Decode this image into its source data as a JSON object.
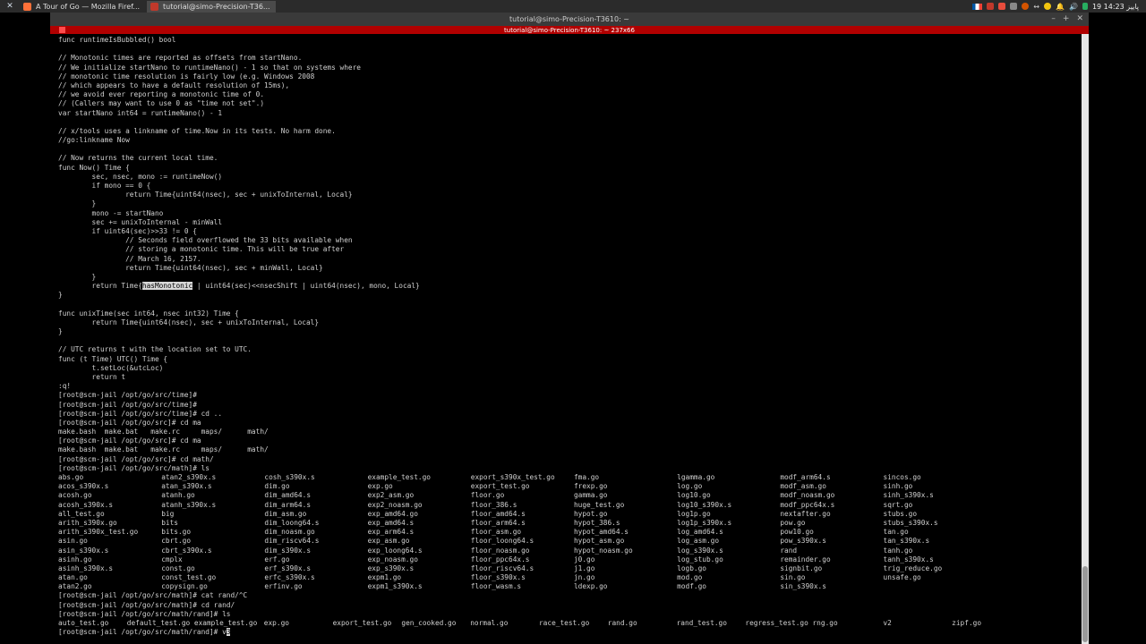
{
  "taskbar": {
    "tasks": [
      {
        "label": "A Tour of Go — Mozilla Firef...",
        "icon": "firefox-icon"
      },
      {
        "label": "tutorial@simo-Precision-T36...",
        "icon": "terminal-icon"
      }
    ],
    "clock": "19 پاییز 14:23"
  },
  "window": {
    "title": "tutorial@simo-Precision-T3610: ~",
    "tab_title": "tutorial@simo-Precision-T3610: ~ 237x66"
  },
  "terminal": {
    "code_lines": [
      "func runtimeIsBubbled() bool",
      "",
      "// Monotonic times are reported as offsets from startNano.",
      "// We initialize startNano to runtimeNano() - 1 so that on systems where",
      "// monotonic time resolution is fairly low (e.g. Windows 2008",
      "// which appears to have a default resolution of 15ms),",
      "// we avoid ever reporting a monotonic time of 0.",
      "// (Callers may want to use 0 as \"time not set\".)",
      "var startNano int64 = runtimeNano() - 1",
      "",
      "// x/tools uses a linkname of time.Now in its tests. No harm done.",
      "//go:linkname Now",
      "",
      "// Now returns the current local time.",
      "func Now() Time {",
      "        sec, nsec, mono := runtimeNow()",
      "        if mono == 0 {",
      "                return Time{uint64(nsec), sec + unixToInternal, Local}",
      "        }",
      "        mono -= startNano",
      "        sec += unixToInternal - minWall",
      "        if uint64(sec)>>33 != 0 {",
      "                // Seconds field overflowed the 33 bits available when",
      "                // storing a monotonic time. This will be true after",
      "                // March 16, 2157.",
      "                return Time{uint64(nsec), sec + minWall, Local}",
      "        }"
    ],
    "hl_line": {
      "before": "        return Time{",
      "highlight": "hasMonotonic",
      "after": " | uint64(sec)<<nsecShift | uint64(nsec), mono, Local}"
    },
    "code_lines_2": [
      "}",
      "",
      "func unixTime(sec int64, nsec int32) Time {",
      "        return Time{uint64(nsec), sec + unixToInternal, Local}",
      "}",
      "",
      "// UTC returns t with the location set to UTC.",
      "func (t Time) UTC() Time {",
      "        t.setLoc(&utcLoc)",
      "        return t",
      ":q!",
      "[root@scm-jail /opt/go/src/time]#",
      "[root@scm-jail /opt/go/src/time]#",
      "[root@scm-jail /opt/go/src/time]# cd ..",
      "[root@scm-jail /opt/go/src]# cd ma",
      "make.bash  make.bat   make.rc     maps/      math/",
      "[root@scm-jail /opt/go/src]# cd ma",
      "make.bash  make.bat   make.rc     maps/      math/",
      "[root@scm-jail /opt/go/src]# cd math/",
      "[root@scm-jail /opt/go/src/math]# ls"
    ],
    "ls_rows": [
      [
        "abs.go",
        "atan2_s390x.s",
        "cosh_s390x.s",
        "example_test.go",
        "export_s390x_test.go",
        "fma.go",
        "lgamma.go",
        "modf_arm64.s",
        "sincos.go"
      ],
      [
        "acos_s390x.s",
        "atan_s390x.s",
        "dim.go",
        "exp.go",
        "export_test.go",
        "frexp.go",
        "log.go",
        "modf_asm.go",
        "sinh.go"
      ],
      [
        "acosh.go",
        "atanh.go",
        "dim_amd64.s",
        "exp2_asm.go",
        "floor.go",
        "gamma.go",
        "log10.go",
        "modf_noasm.go",
        "sinh_s390x.s"
      ],
      [
        "acosh_s390x.s",
        "atanh_s390x.s",
        "dim_arm64.s",
        "exp2_noasm.go",
        "floor_386.s",
        "huge_test.go",
        "log10_s390x.s",
        "modf_ppc64x.s",
        "sqrt.go"
      ],
      [
        "all_test.go",
        "big",
        "dim_asm.go",
        "exp_amd64.go",
        "floor_amd64.s",
        "hypot.go",
        "log1p.go",
        "nextafter.go",
        "stubs.go"
      ],
      [
        "arith_s390x.go",
        "bits",
        "dim_loong64.s",
        "exp_amd64.s",
        "floor_arm64.s",
        "hypot_386.s",
        "log1p_s390x.s",
        "pow.go",
        "stubs_s390x.s"
      ],
      [
        "arith_s390x_test.go",
        "bits.go",
        "dim_noasm.go",
        "exp_arm64.s",
        "floor_asm.go",
        "hypot_amd64.s",
        "log_amd64.s",
        "pow10.go",
        "tan.go"
      ],
      [
        "asin.go",
        "cbrt.go",
        "dim_riscv64.s",
        "exp_asm.go",
        "floor_loong64.s",
        "hypot_asm.go",
        "log_asm.go",
        "pow_s390x.s",
        "tan_s390x.s"
      ],
      [
        "asin_s390x.s",
        "cbrt_s390x.s",
        "dim_s390x.s",
        "exp_loong64.s",
        "floor_noasm.go",
        "hypot_noasm.go",
        "log_s390x.s",
        "rand",
        "tanh.go"
      ],
      [
        "asinh.go",
        "cmplx",
        "erf.go",
        "exp_noasm.go",
        "floor_ppc64x.s",
        "j0.go",
        "log_stub.go",
        "remainder.go",
        "tanh_s390x.s"
      ],
      [
        "asinh_s390x.s",
        "const.go",
        "erf_s390x.s",
        "exp_s390x.s",
        "floor_riscv64.s",
        "j1.go",
        "logb.go",
        "signbit.go",
        "trig_reduce.go"
      ],
      [
        "atan.go",
        "const_test.go",
        "erfc_s390x.s",
        "expm1.go",
        "floor_s390x.s",
        "jn.go",
        "mod.go",
        "sin.go",
        "unsafe.go"
      ],
      [
        "atan2.go",
        "copysign.go",
        "erfinv.go",
        "expm1_s390x.s",
        "floor_wasm.s",
        "ldexp.go",
        "modf.go",
        "sin_s390x.s",
        ""
      ]
    ],
    "tail_lines": [
      "[root@scm-jail /opt/go/src/math]# cat rand/^C",
      "[root@scm-jail /opt/go/src/math]# cd rand/",
      "[root@scm-jail /opt/go/src/math/rand]# ls"
    ],
    "rand_ls": [
      "auto_test.go",
      "default_test.go example_test.go",
      "exp.go",
      "export_test.go",
      "gen_cooked.go",
      "normal.go",
      "race_test.go",
      "rand.go",
      "rand_test.go",
      "regress_test.go rng.go",
      "v2",
      "zipf.go"
    ],
    "prompt": "[root@scm-jail /opt/go/src/math/rand]# v",
    "cursor_char": "3"
  }
}
